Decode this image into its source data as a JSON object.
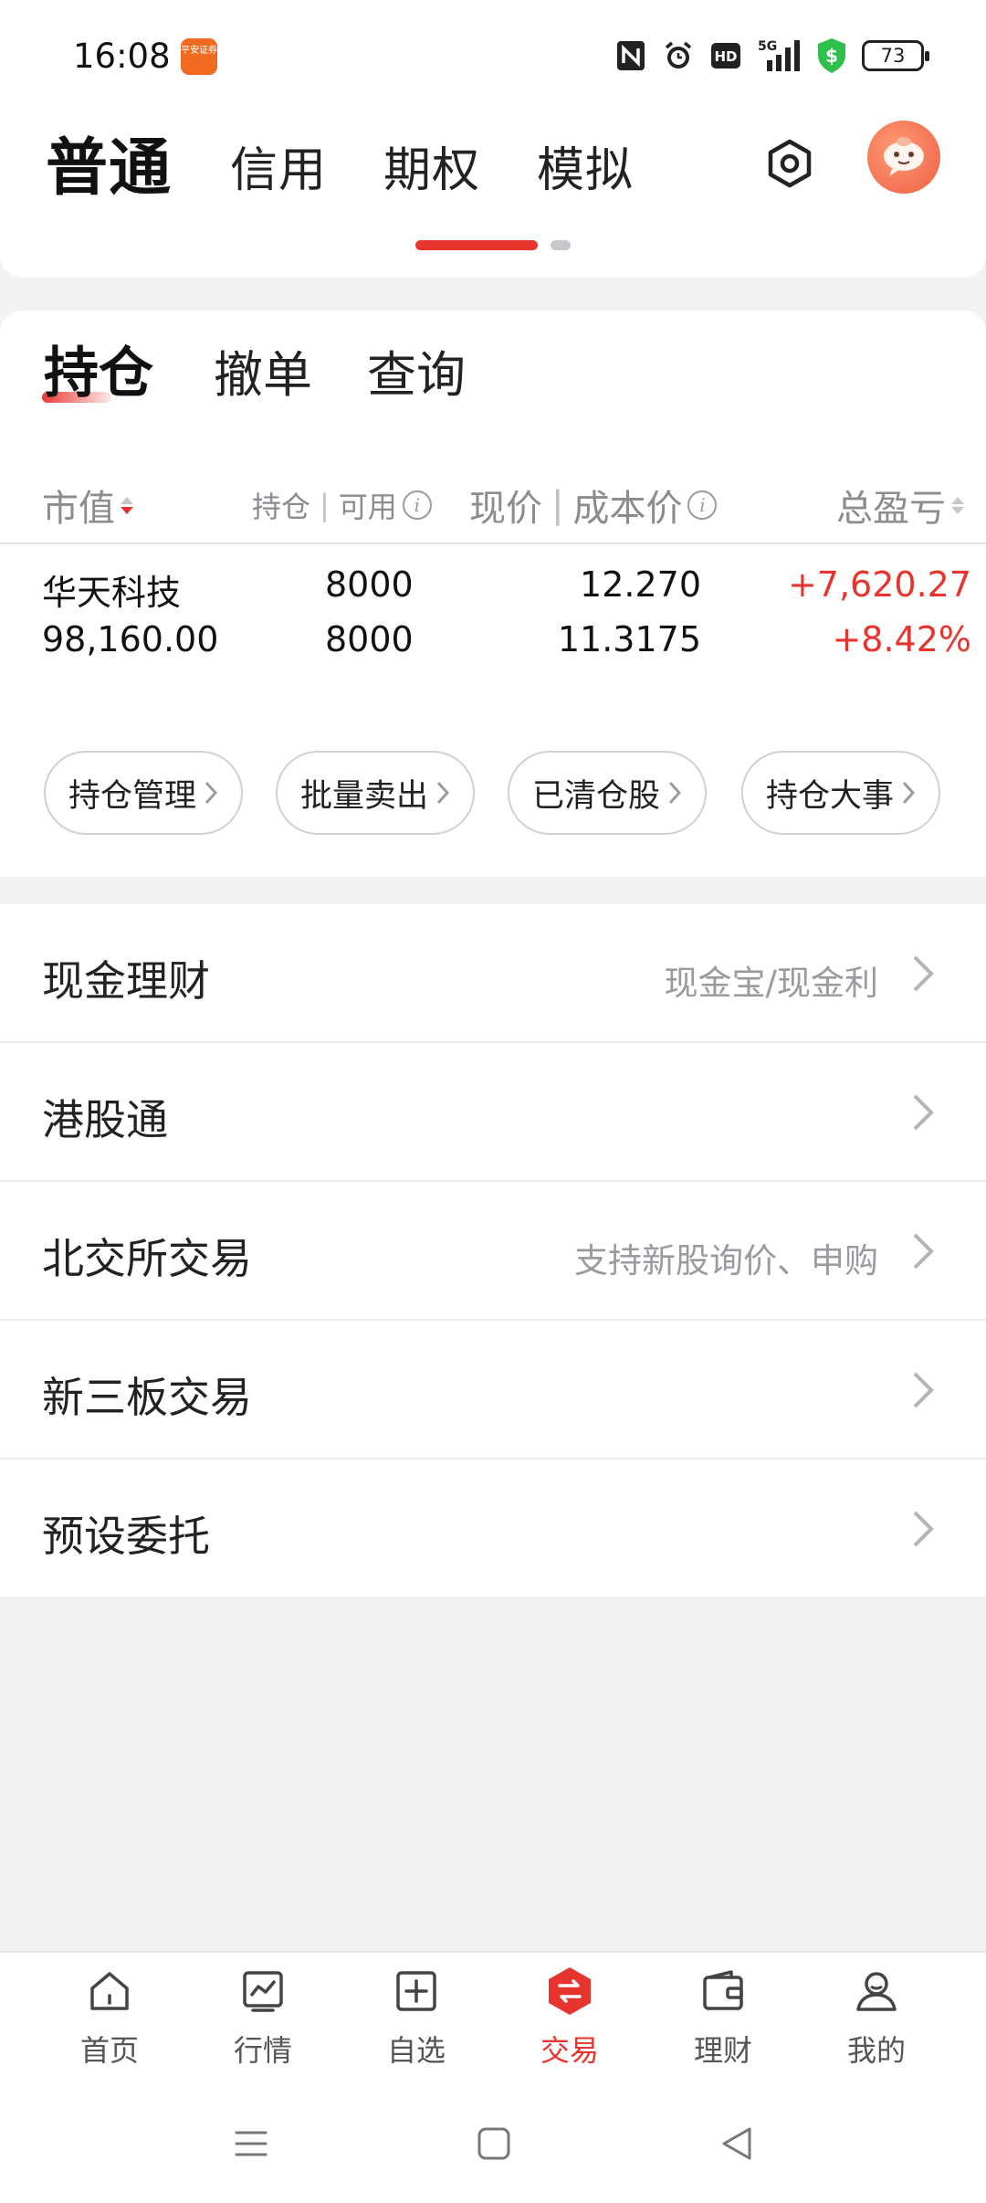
{
  "status_bar": {
    "time": "16:08",
    "app_icon_text": "平安证券",
    "network": "5G",
    "battery": "73",
    "icons": [
      "nfc-icon",
      "alarm-icon",
      "hd-icon",
      "signal-icon",
      "shield-dollar-icon",
      "battery-icon"
    ]
  },
  "account_tabs": {
    "items": [
      {
        "label": "普通",
        "active": true
      },
      {
        "label": "信用",
        "active": false
      },
      {
        "label": "期权",
        "active": false
      },
      {
        "label": "模拟",
        "active": false
      }
    ],
    "page_indicator": {
      "count": 2,
      "active_index": 0
    }
  },
  "sub_tabs": {
    "items": [
      {
        "label": "持仓",
        "active": true
      },
      {
        "label": "撤单",
        "active": false
      },
      {
        "label": "查询",
        "active": false
      }
    ]
  },
  "holdings_table": {
    "headers": {
      "market_value": "市值",
      "position": "持仓",
      "available": "可用",
      "current_price": "现价",
      "cost_price": "成本价",
      "total_pnl": "总盈亏"
    },
    "rows": [
      {
        "name": "华天科技",
        "market_value": "98,160.00",
        "position": "8000",
        "available": "8000",
        "current_price": "12.270",
        "cost_price": "11.3175",
        "pnl": "+7,620.27",
        "pnl_pct": "+8.42%"
      }
    ]
  },
  "quick_actions": [
    {
      "label": "持仓管理"
    },
    {
      "label": "批量卖出"
    },
    {
      "label": "已清仓股"
    },
    {
      "label": "持仓大事"
    }
  ],
  "menu": [
    {
      "label": "现金理财",
      "hint": "现金宝/现金利"
    },
    {
      "label": "港股通",
      "hint": ""
    },
    {
      "label": "北交所交易",
      "hint": "支持新股询价、申购"
    },
    {
      "label": "新三板交易",
      "hint": ""
    },
    {
      "label": "预设委托",
      "hint": ""
    }
  ],
  "bottom_nav": [
    {
      "label": "首页",
      "icon": "home-icon",
      "active": false
    },
    {
      "label": "行情",
      "icon": "chart-icon",
      "active": false
    },
    {
      "label": "自选",
      "icon": "add-square-icon",
      "active": false
    },
    {
      "label": "交易",
      "icon": "exchange-icon",
      "active": true
    },
    {
      "label": "理财",
      "icon": "wallet-icon",
      "active": false
    },
    {
      "label": "我的",
      "icon": "user-icon",
      "active": false
    }
  ],
  "colors": {
    "accent": "#e8342e",
    "gain": "#e8342e",
    "background": "#f2f2f4"
  }
}
